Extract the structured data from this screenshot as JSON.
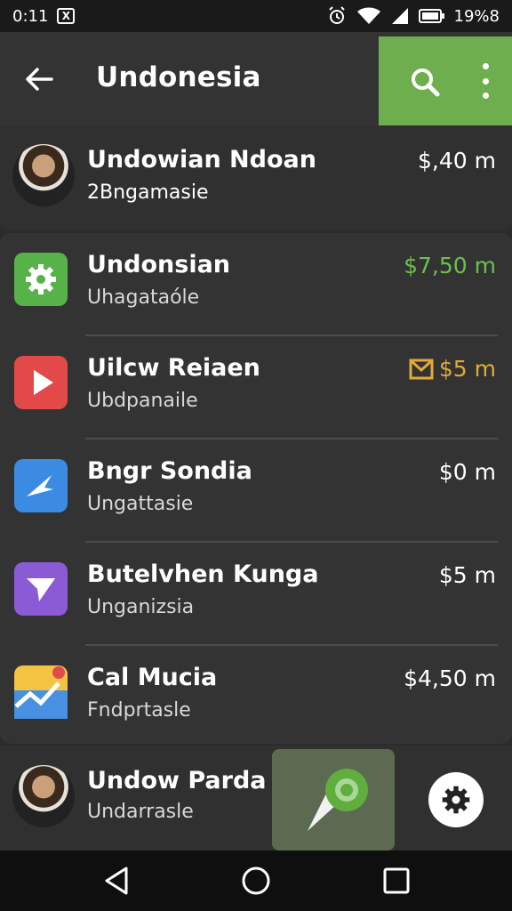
{
  "status": {
    "time": "0:11",
    "x_label": "X",
    "battery": "19%8"
  },
  "toolbar": {
    "title": "Undonesia",
    "back_icon": "arrow-left-icon",
    "search_icon": "search-icon",
    "more_icon": "more-vert-icon",
    "accent": "#6fae4f"
  },
  "profile": {
    "name": "Undowian Ndoan",
    "subtitle": "2Bngamasie",
    "amount": "$,40 m"
  },
  "rows": [
    {
      "name": "Undonsian",
      "subtitle": "Uhagataóle",
      "amount": "$7,50 m",
      "amount_color": "#6cc04a",
      "icon": "gear-icon",
      "icon_bg": "#58b24a"
    },
    {
      "name": "Uilcw Reiaen",
      "subtitle": "Ubdpanaile",
      "amount": "$5 m",
      "amount_color": "#e2a93a",
      "icon": "play-icon",
      "icon_bg": "#e24a4a",
      "badge_icon": "mail-icon"
    },
    {
      "name": "Bngr Sondia",
      "subtitle": "Ungattasie",
      "amount": "$0 m",
      "amount_color": "#ffffff",
      "icon": "plane-icon",
      "icon_bg": "#3b8be3"
    },
    {
      "name": "Butelvhen Kunga",
      "subtitle": "Unganizsia",
      "amount": "$5 m",
      "amount_color": "#ffffff",
      "icon": "send-icon",
      "icon_bg": "#8b5bd6"
    },
    {
      "name": "Cal Mucia",
      "subtitle": "Fndprtasle",
      "amount": "$4,50 m",
      "amount_color": "#ffffff",
      "icon": "chart-map-icon",
      "icon_bg": "#f3c441"
    }
  ],
  "bottom": {
    "name": "Undow Parda",
    "subtitle": "Undarrasle",
    "map_icon": "map-pin-icon",
    "settings_icon": "gear-icon"
  },
  "nav": {
    "back_icon": "nav-back-icon",
    "home_icon": "nav-home-icon",
    "recents_icon": "nav-recents-icon"
  }
}
